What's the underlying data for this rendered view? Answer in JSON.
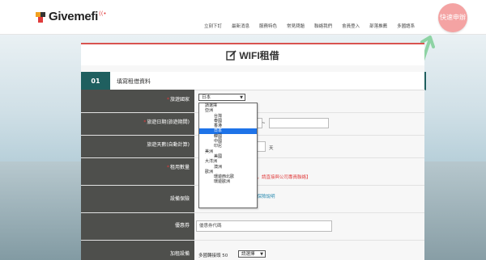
{
  "header": {
    "brand": "Givemefi",
    "nav": [
      "立刻下訂",
      "最新消息",
      "服務特色",
      "常見問題",
      "聯絡我們",
      "會員登入",
      "部落推薦",
      "多國語系"
    ],
    "apply_button": "快速申辦"
  },
  "page_title": "WIFI租借",
  "section": {
    "number": "01",
    "title": "填寫租借資料"
  },
  "form": {
    "country_label": "旅遊國家",
    "country_value": "日本",
    "dates_label": "旅遊日期(旅遊期間)",
    "date_separator": "~",
    "days_label": "旅遊天數(自動計算)",
    "days_unit": "天",
    "quantity_label": "租用數量",
    "quantity_note": "上，請直接與公司專員聯絡】",
    "insurance_label": "設備保險",
    "insurance_link": "心保險說明",
    "insurance_note": "半",
    "coupon_label": "優惠券",
    "coupon_placeholder": "優惠券代碼",
    "addon_label": "加租設備",
    "addon_text": "多國轉接頭 50",
    "addon_select": "請選擇"
  },
  "dropdown": {
    "items": [
      {
        "text": "請選擇",
        "kind": "first"
      },
      {
        "text": "亞洲",
        "kind": "group"
      },
      {
        "text": "台灣",
        "kind": "opt"
      },
      {
        "text": "泰國",
        "kind": "opt"
      },
      {
        "text": "香港",
        "kind": "opt"
      },
      {
        "text": "日本",
        "kind": "opt",
        "selected": true
      },
      {
        "text": "韓國",
        "kind": "opt"
      },
      {
        "text": "中國",
        "kind": "opt"
      },
      {
        "text": "印尼",
        "kind": "opt"
      },
      {
        "text": "美洲",
        "kind": "group"
      },
      {
        "text": "美國",
        "kind": "opt"
      },
      {
        "text": "大洋洲",
        "kind": "group"
      },
      {
        "text": "澳洲",
        "kind": "opt"
      },
      {
        "text": "歐洲",
        "kind": "group"
      },
      {
        "text": "環遊西北歐",
        "kind": "opt"
      },
      {
        "text": "環遊歐洲",
        "kind": "opt"
      }
    ]
  },
  "colors": {
    "accent_red": "#d9534f",
    "section_teal": "#1f5f5f",
    "label_bg": "#4e4f4c",
    "apply_pink": "#f4a3a3",
    "selected_blue": "#1e73e8"
  },
  "icons": [
    "wifi-icon",
    "edit-icon",
    "arrow-up-icon"
  ]
}
